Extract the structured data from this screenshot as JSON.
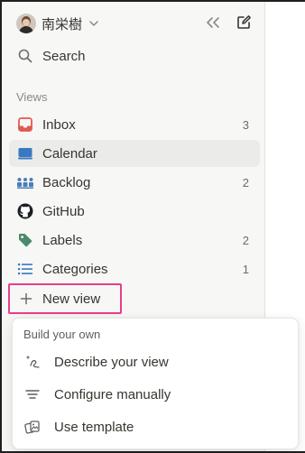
{
  "workspace": {
    "name": "南栄樹"
  },
  "search": {
    "label": "Search"
  },
  "views": {
    "section_title": "Views",
    "items": [
      {
        "label": "Inbox",
        "count": "3",
        "icon": "inbox-icon"
      },
      {
        "label": "Calendar",
        "count": "",
        "icon": "calendar-icon"
      },
      {
        "label": "Backlog",
        "count": "2",
        "icon": "backlog-icon"
      },
      {
        "label": "GitHub",
        "count": "",
        "icon": "github-icon"
      },
      {
        "label": "Labels",
        "count": "2",
        "icon": "tag-icon"
      },
      {
        "label": "Categories",
        "count": "1",
        "icon": "list-icon"
      }
    ],
    "new_view_label": "New view"
  },
  "popup": {
    "title": "Build your own",
    "items": [
      {
        "label": "Describe your view",
        "icon": "sparkle-pen-icon"
      },
      {
        "label": "Configure manually",
        "icon": "filter-lines-icon"
      },
      {
        "label": "Use template",
        "icon": "template-icon"
      }
    ]
  },
  "colors": {
    "inbox": "#e05a4f",
    "calendar": "#3a78c2",
    "backlog": "#4a7fb8",
    "labels": "#4c8a6c",
    "categories": "#3a78c2",
    "highlight": "#e83e8c"
  }
}
